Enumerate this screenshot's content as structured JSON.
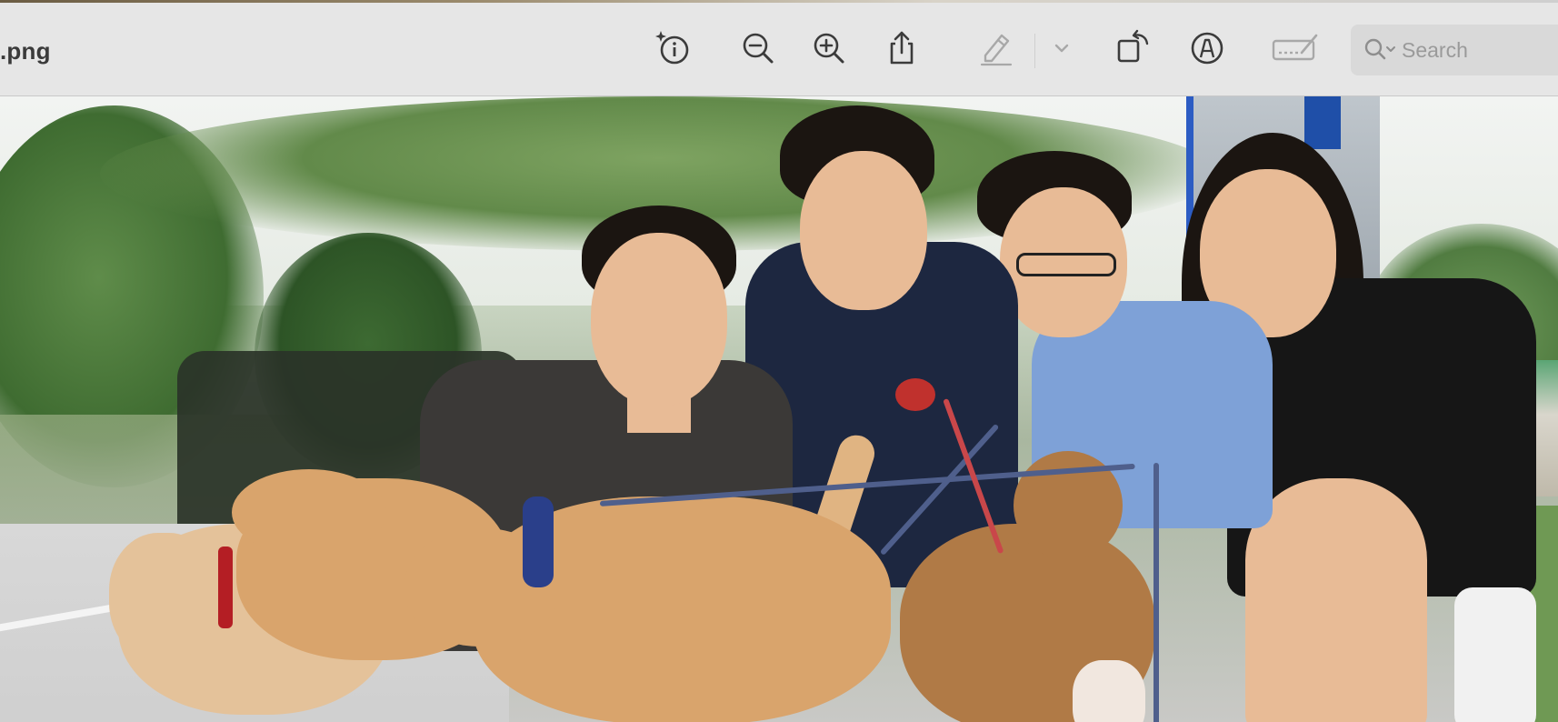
{
  "window": {
    "title": ".png"
  },
  "toolbar": {
    "buttons": [
      {
        "name": "info-button",
        "icon": "sparkle-info-icon"
      },
      {
        "name": "zoom-out-button",
        "icon": "zoom-out-icon"
      },
      {
        "name": "zoom-in-button",
        "icon": "zoom-in-icon"
      },
      {
        "name": "share-button",
        "icon": "share-icon"
      },
      {
        "name": "highlight-button",
        "icon": "highlighter-pen-icon"
      },
      {
        "name": "highlight-menu-button",
        "icon": "chevron-down-icon"
      },
      {
        "name": "rotate-button",
        "icon": "rotate-icon"
      },
      {
        "name": "markup-button",
        "icon": "markup-pen-circle-icon"
      },
      {
        "name": "fill-sign-button",
        "icon": "signature-icon"
      }
    ],
    "search": {
      "placeholder": "Search"
    }
  },
  "colors": {
    "toolbar_bg": "#e6e6e6",
    "icon": "#3b3b3b",
    "icon_disabled": "#a8a8a8",
    "search_bg": "#d9d9d9"
  }
}
